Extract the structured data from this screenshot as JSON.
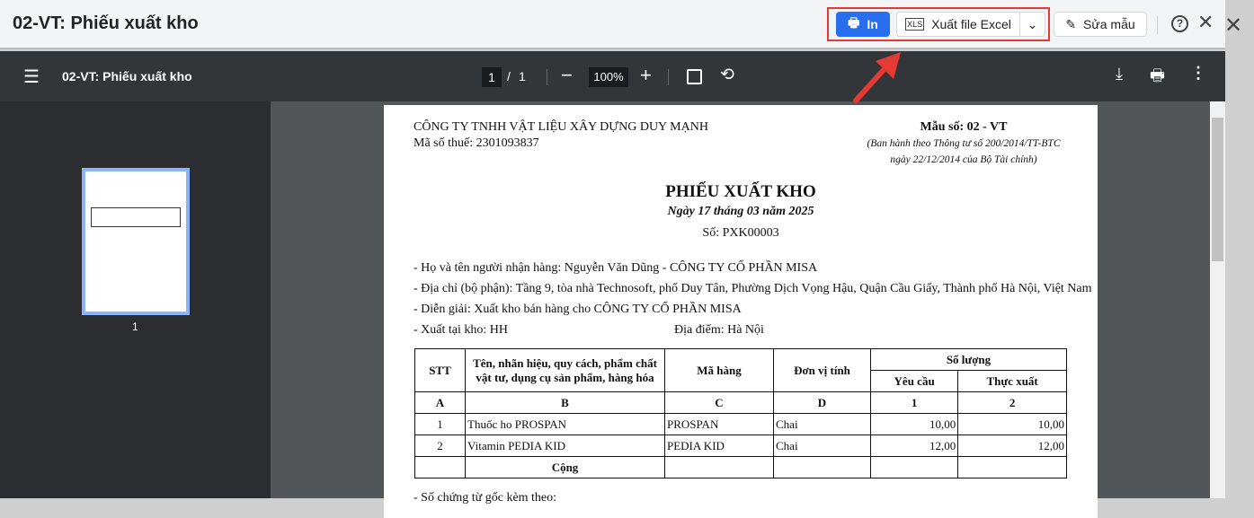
{
  "header": {
    "title": "02-VT: Phiếu xuất kho",
    "print_label": "In",
    "excel_label": "Xuất file Excel",
    "edit_label": "Sửa mẫu"
  },
  "viewer": {
    "doc_title": "02-VT: Phiếu xuất kho",
    "page_current": "1",
    "page_sep": "/",
    "page_total": "1",
    "zoom": "100%",
    "thumb_label": "1"
  },
  "doc": {
    "company": "CÔNG TY TNHH VẬT LIỆU XÂY DỰNG DUY MẠNH",
    "tax": "Mã số thuế: 2301093837",
    "form_no": "Mẫu số: 02 - VT",
    "form_note1": "(Ban hành theo Thông tư số 200/2014/TT-BTC",
    "form_note2": "ngày 22/12/2014 của Bộ Tài chính)",
    "title": "PHIẾU XUẤT KHO",
    "date": "Ngày 17 tháng 03 năm 2025",
    "number": "Số: PXK00003",
    "receiver": "- Họ và tên người nhận hàng: Nguyễn Văn Dũng - CÔNG TY CỔ PHẦN MISA",
    "address": "- Địa chỉ (bộ phận): Tầng 9, tòa nhà Technosoft, phố Duy Tân, Phường Dịch Vọng Hậu, Quận Cầu Giấy, Thành phố Hà Nội, Việt Nam",
    "desc": "- Diễn giải: Xuất kho bán hàng cho CÔNG TY CỔ PHẦN MISA",
    "warehouse": "- Xuất tại kho: HH",
    "location": "Địa điểm: Hà Nội",
    "cols": {
      "stt": "STT",
      "name": "Tên, nhãn hiệu, quy cách, phẩm chất vật tư, dụng cụ sản phẩm, hàng hóa",
      "code": "Mã hàng",
      "unit": "Đơn vị tính",
      "qty": "Số lượng",
      "req": "Yêu cầu",
      "act": "Thực xuất"
    },
    "letters": [
      "A",
      "B",
      "C",
      "D",
      "1",
      "2"
    ],
    "rows": [
      [
        "1",
        "Thuốc ho PROSPAN",
        "PROSPAN",
        "Chai",
        "10,00",
        "10,00"
      ],
      [
        "2",
        "Vitamin PEDIA KID",
        "PEDIA KID",
        "Chai",
        "12,00",
        "12,00"
      ]
    ],
    "total": "Cộng",
    "attach": "- Số chứng từ gốc kèm theo:"
  }
}
